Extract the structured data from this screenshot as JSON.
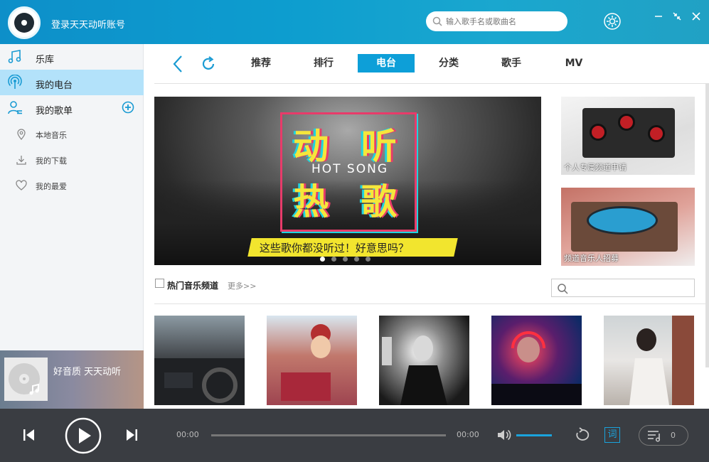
{
  "header": {
    "login_text": "登录天天动听账号",
    "search_placeholder": "输入歌手名或歌曲名"
  },
  "sidebar": {
    "items": [
      {
        "label": "乐库"
      },
      {
        "label": "我的电台"
      },
      {
        "label": "我的歌单"
      }
    ],
    "sub_items": [
      {
        "label": "本地音乐"
      },
      {
        "label": "我的下载"
      },
      {
        "label": "我的最爱"
      }
    ]
  },
  "now_playing": {
    "text": "好音质 天天动听"
  },
  "tabs": [
    {
      "label": "推荐"
    },
    {
      "label": "排行"
    },
    {
      "label": "电台"
    },
    {
      "label": "分类"
    },
    {
      "label": "歌手"
    },
    {
      "label": "MV"
    }
  ],
  "active_tab": "电台",
  "banner": {
    "title1": "动 听",
    "subtitle": "HOT SONG",
    "title2": "热 歌",
    "tagline": "这些歌你都没听过！好意思吗？",
    "slide_count": 5,
    "active_slide": 1
  },
  "side_banners": [
    {
      "caption": "个人专属频道申请"
    },
    {
      "caption": "频道音乐人招募"
    }
  ],
  "section": {
    "title": "热门音乐频道",
    "more": "更多>>"
  },
  "player": {
    "current_time": "00:00",
    "total_time": "00:00",
    "lyric_label": "词",
    "queue_count": "0"
  },
  "colors": {
    "accent": "#0d9fd8",
    "header": "#0d8fc9",
    "player_bg": "#3a3d42",
    "sidebar_active": "#b3e2fa"
  }
}
